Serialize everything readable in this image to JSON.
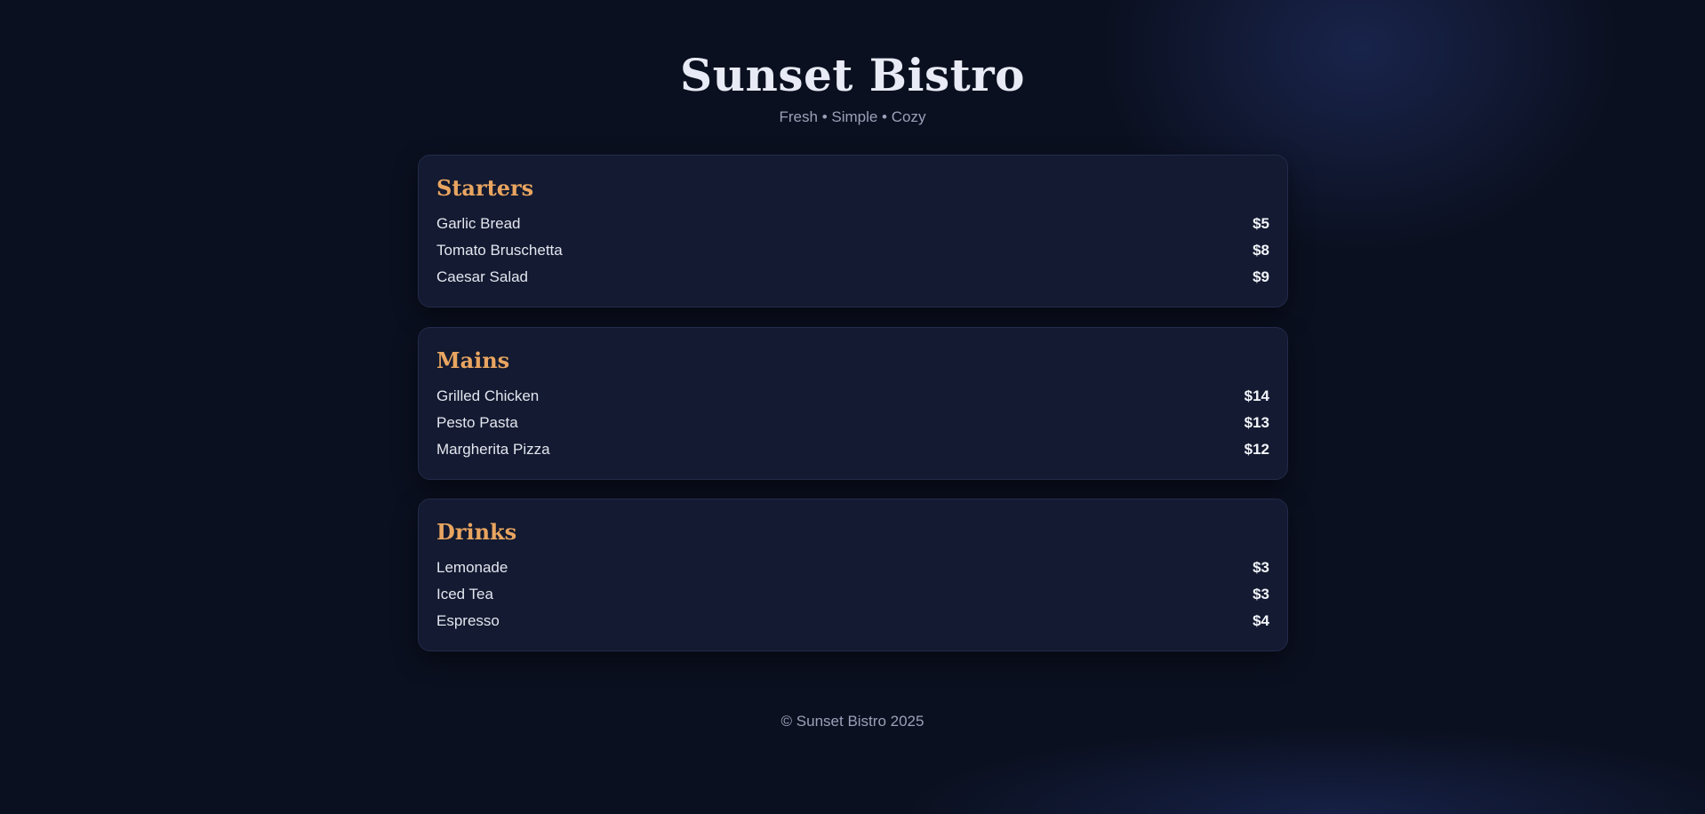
{
  "header": {
    "title": "Sunset Bistro",
    "tagline": "Fresh • Simple • Cozy"
  },
  "sections": [
    {
      "title": "Starters",
      "items": [
        {
          "name": "Garlic Bread",
          "price": "$5"
        },
        {
          "name": "Tomato Bruschetta",
          "price": "$8"
        },
        {
          "name": "Caesar Salad",
          "price": "$9"
        }
      ]
    },
    {
      "title": "Mains",
      "items": [
        {
          "name": "Grilled Chicken",
          "price": "$14"
        },
        {
          "name": "Pesto Pasta",
          "price": "$13"
        },
        {
          "name": "Margherita Pizza",
          "price": "$12"
        }
      ]
    },
    {
      "title": "Drinks",
      "items": [
        {
          "name": "Lemonade",
          "price": "$3"
        },
        {
          "name": "Iced Tea",
          "price": "$3"
        },
        {
          "name": "Espresso",
          "price": "$4"
        }
      ]
    }
  ],
  "footer": {
    "text": "© Sunset Bistro 2025"
  },
  "colors": {
    "background": "#0b1020",
    "card": "#131a31",
    "accent": "#e9a560",
    "muted": "#9aa1b8"
  }
}
